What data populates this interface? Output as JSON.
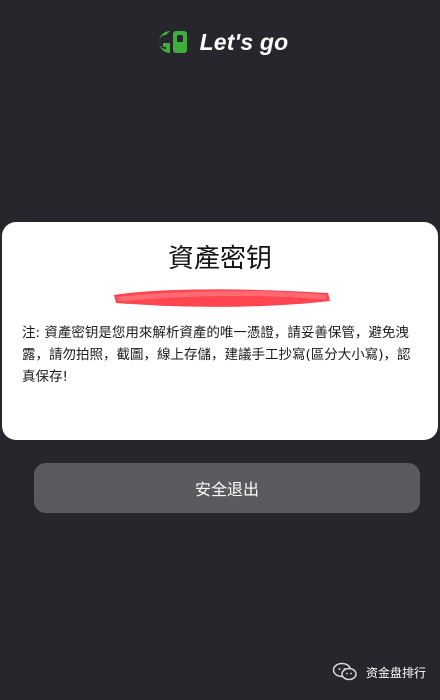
{
  "brand": {
    "logo_icon": "lets-go-logo-icon",
    "name": "Let's go",
    "accent_color": "#3fae3a"
  },
  "card": {
    "title": "資產密钥",
    "key_value_visible": "",
    "redaction_color": "#ff3b47",
    "note": "注: 資產密钥是您用來解析資產的唯一憑證，請妥善保管，避免洩露，請勿拍照，截圖，線上存儲，建議手工抄寫(區分大小寫)，認真保存!"
  },
  "actions": {
    "logout_label": "安全退出"
  },
  "watermark": {
    "icon": "wechat-icon",
    "text": "资金盘排行"
  }
}
